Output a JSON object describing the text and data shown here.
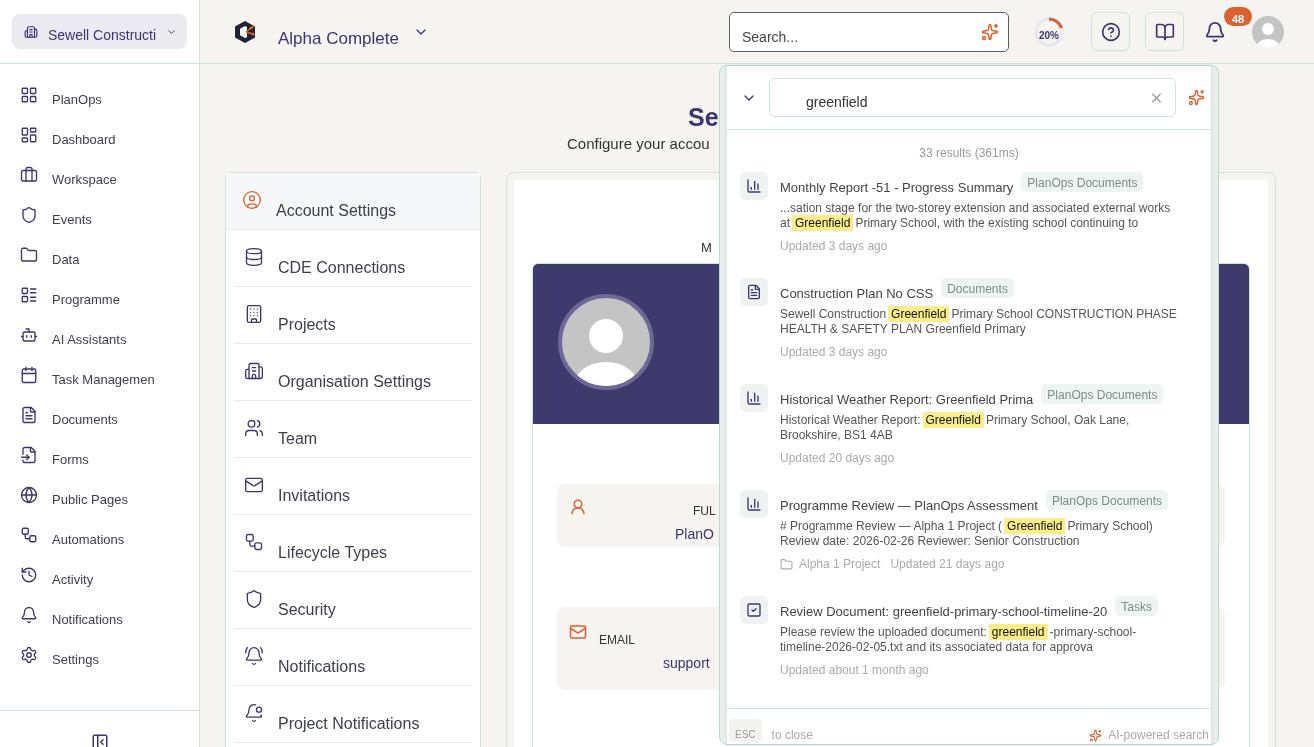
{
  "org_switcher": {
    "label": "Sewell Constructi"
  },
  "sidebar": {
    "items": [
      {
        "kind": "grid",
        "label": "PlanOps"
      },
      {
        "kind": "dashboard",
        "label": "Dashboard"
      },
      {
        "kind": "briefcase",
        "label": "Workspace"
      },
      {
        "kind": "shield",
        "label": "Events"
      },
      {
        "kind": "folder",
        "label": "Data"
      },
      {
        "kind": "programme",
        "label": "Programme"
      },
      {
        "kind": "bot",
        "label": "AI Assistants"
      },
      {
        "kind": "calendar",
        "label": "Task Managemen"
      },
      {
        "kind": "document",
        "label": "Documents"
      },
      {
        "kind": "form",
        "label": "Forms"
      },
      {
        "kind": "globe",
        "label": "Public Pages"
      },
      {
        "kind": "workflow",
        "label": "Automations"
      },
      {
        "kind": "history",
        "label": "Activity"
      },
      {
        "kind": "bell",
        "label": "Notifications"
      },
      {
        "kind": "gear",
        "label": "Settings"
      }
    ]
  },
  "header": {
    "project": "Alpha Complete",
    "search": {
      "placeholder": "Search..."
    },
    "progress": {
      "level": 0.2,
      "reading": "20%"
    },
    "notification_count": "48"
  },
  "page": {
    "title": "Se",
    "subtitle": "Configure your accou",
    "settings_menu": [
      {
        "kind": "user",
        "label": "Account Settings",
        "selected": true
      },
      {
        "kind": "database",
        "label": "CDE Connections",
        "selected": false
      },
      {
        "kind": "building",
        "label": "Projects",
        "selected": false
      },
      {
        "kind": "organisation",
        "label": "Organisation Settings",
        "selected": false
      },
      {
        "kind": "team",
        "label": "Team",
        "selected": false
      },
      {
        "kind": "mail",
        "label": "Invitations",
        "selected": false
      },
      {
        "kind": "workflow",
        "label": "Lifecycle Types",
        "selected": false
      },
      {
        "kind": "shield",
        "label": "Security",
        "selected": false
      },
      {
        "kind": "bell",
        "label": "Notifications",
        "selected": false
      },
      {
        "kind": "bell-dot",
        "label": "Project Notifications",
        "selected": false
      }
    ],
    "profile": {
      "heading": "M",
      "fields": [
        {
          "kind": "name",
          "label": "FUL",
          "value": "PlanO"
        },
        {
          "kind": "email",
          "label": "EMAIL",
          "value": "support"
        }
      ]
    }
  },
  "search_popup": {
    "query": "greenfield",
    "summary": "33 results (361ms)",
    "results": [
      {
        "kind": "chart",
        "title": "Monthly Report -51 - Progress Summary",
        "tag": "PlanOps Documents",
        "snippet": {
          "before": "...sation stage for the two-storey extension and associated external works at",
          "match": "Greenfield",
          "after": "Primary School, with the existing school continuing to"
        },
        "updated": "Updated 3 days ago"
      },
      {
        "kind": "document",
        "title": "Construction Plan No CSS",
        "tag": "Documents",
        "snippet": {
          "before": "Sewell Construction",
          "match": "Greenfield",
          "after": "Primary School CONSTRUCTION PHASE HEALTH & SAFETY PLAN Greenfield Primary"
        },
        "updated": "Updated 3 days ago"
      },
      {
        "kind": "chart",
        "title": "Historical Weather Report: Greenfield Prima",
        "tag": "PlanOps Documents",
        "snippet": {
          "before": "Historical Weather Report:",
          "match": "Greenfield",
          "after": "Primary School, Oak Lane, Brookshire, BS1 4AB"
        },
        "updated": "Updated 20 days ago"
      },
      {
        "kind": "chart",
        "title": "Programme Review — PlanOps Assessment",
        "tag": "PlanOps Documents",
        "snippet": {
          "before": "# Programme Review — Alpha 1 Project (",
          "match": "Greenfield",
          "after": "Primary School) Review date: 2026-02-26 Reviewer: Senior Construction"
        },
        "project": "Alpha 1 Project",
        "updated": "Updated 21 days ago"
      },
      {
        "kind": "task",
        "title": "Review Document: greenfield-primary-school-timeline-20",
        "tag": "Tasks",
        "snippet": {
          "before": "Please review the uploaded document:",
          "match": "greenfield",
          "after": "-primary-school-timeline-2026-02-05.txt and its associated data for approva"
        },
        "updated": "Updated about 1 month ago"
      }
    ],
    "footer": {
      "key": "ESC",
      "hint": "to close",
      "ai_label": "AI-powered search"
    }
  }
}
